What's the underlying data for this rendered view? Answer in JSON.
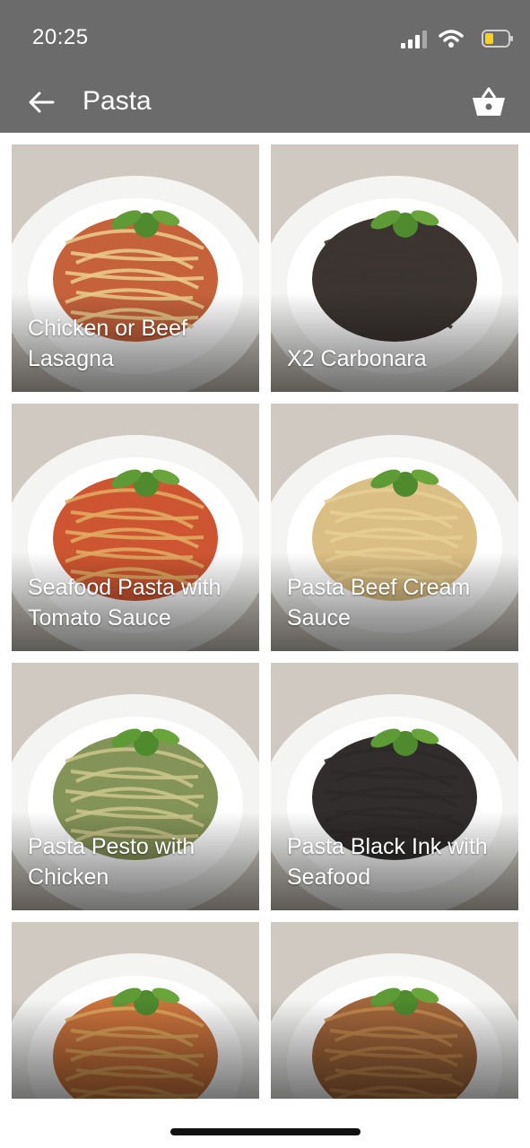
{
  "status_bar": {
    "time": "20:25",
    "icons": [
      "signal-icon",
      "wifi-icon",
      "battery-icon"
    ]
  },
  "header": {
    "title": "Pasta",
    "back_icon": "arrow-left-icon",
    "cart_icon": "basket-icon",
    "background_color": "#6b6b6b"
  },
  "menu_items": [
    {
      "name": "Chicken or Beef Lasagna",
      "sauce": "#c0552a",
      "noodle": "#e8c889"
    },
    {
      "name": "X2 Carbonara",
      "sauce": "#2a2320",
      "noodle": "#3b3431"
    },
    {
      "name": "Seafood Pasta with Tomato Sauce",
      "sauce": "#c9471f",
      "noodle": "#e0a861"
    },
    {
      "name": "Pasta Beef Cream Sauce",
      "sauce": "#d8b978",
      "noodle": "#e6cd91"
    },
    {
      "name": "Pasta Pesto with Chicken",
      "sauce": "#7a8a4a",
      "noodle": "#c9c48a"
    },
    {
      "name": "Pasta Black Ink with Seafood",
      "sauce": "#1e1b1a",
      "noodle": "#2e2928"
    },
    {
      "name": "",
      "sauce": "#c7682c",
      "noodle": "#e2a75b"
    },
    {
      "name": "",
      "sauce": "#9a5a2a",
      "noodle": "#c88b4f"
    }
  ]
}
